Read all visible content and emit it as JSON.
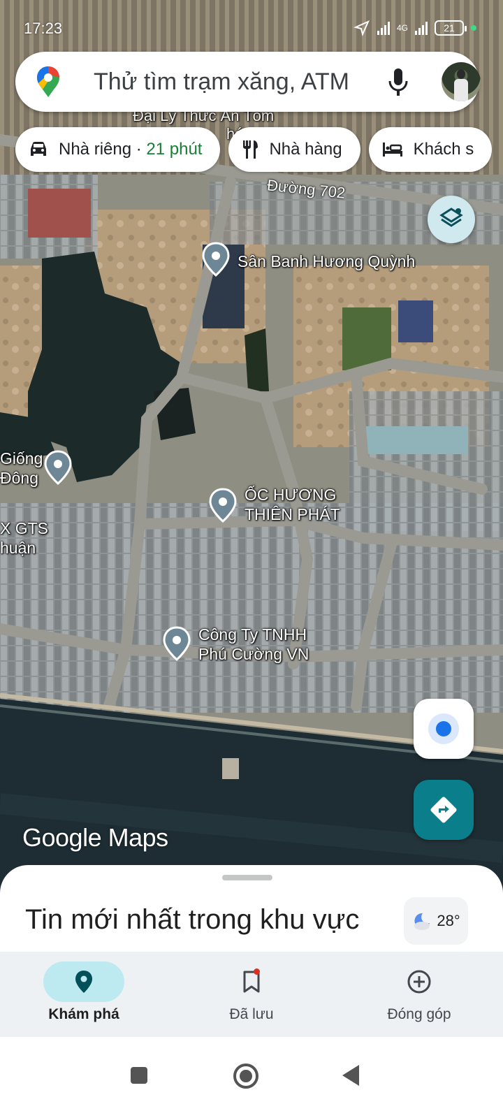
{
  "status_bar": {
    "time": "17:23",
    "battery": "21",
    "network": "4G"
  },
  "search": {
    "placeholder": "Thử tìm trạm xăng, ATM"
  },
  "chips": [
    {
      "label": "Nhà riêng · ",
      "detail": "21 phút",
      "icon": "car-icon"
    },
    {
      "label": "Nhà hàng",
      "icon": "restaurant-icon"
    },
    {
      "label": "Khách s",
      "icon": "hotel-icon"
    }
  ],
  "map": {
    "road_label": "Đường 702",
    "top_partial_label": "Đại Lý Thức Ăn Tôm",
    "top_partial_label_2": "hát",
    "places": [
      {
        "name": "Sân Banh Hương Quỳnh"
      },
      {
        "name_line1": "Giống",
        "name_line2": "Đông"
      },
      {
        "name_line1": "ỐC HƯƠNG",
        "name_line2": "THIÊN PHÁT"
      },
      {
        "name_line1": "X GTS",
        "name_line2": "huận"
      },
      {
        "name_line1": "Công Ty TNHH",
        "name_line2": "Phú Cường VN"
      }
    ],
    "watermark": "Google Maps",
    "colors": {
      "water": "#1c2a2a",
      "sea": "#1d2d33",
      "road": "#9a9a92",
      "accent": "#0b7e8c"
    }
  },
  "sheet": {
    "title": "Tin mới nhất trong khu vực",
    "weather": "28°"
  },
  "nav": [
    {
      "label": "Khám phá",
      "active": true
    },
    {
      "label": "Đã lưu",
      "active": false
    },
    {
      "label": "Đóng góp",
      "active": false
    }
  ]
}
